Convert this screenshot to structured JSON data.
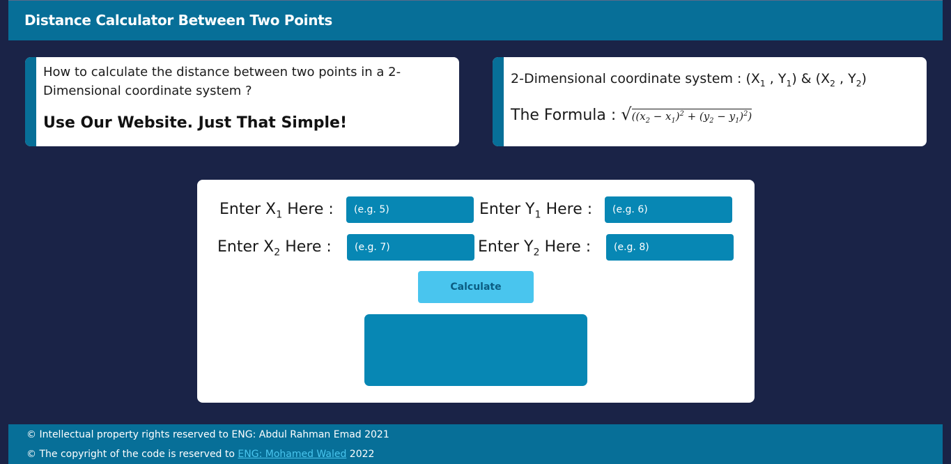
{
  "header": {
    "title": "Distance Calculator Between Two Points"
  },
  "info_card": {
    "question": "How to calculate the distance between two points in a 2-Dimensional coordinate system ?",
    "slogan": "Use Our Website. Just That Simple!"
  },
  "formula_card": {
    "system_label": "2-Dimensional coordinate system : ",
    "formula_label": "The Formula : "
  },
  "form": {
    "x1_label": "Enter X",
    "y1_label": "Enter Y",
    "x2_label": "Enter X",
    "y2_label": "Enter Y",
    "here": " Here :",
    "x1_placeholder": "(e.g. 5)",
    "y1_placeholder": "(e.g. 6)",
    "x2_placeholder": "(e.g. 7)",
    "y2_placeholder": "(e.g. 8)",
    "calculate_label": "Calculate",
    "result": ""
  },
  "footer": {
    "line1": "© Intellectual property rights reserved to ENG: Abdul Rahman Emad 2021",
    "line2_prefix": "© The copyright of the code is reserved to ",
    "line2_link": "ENG: Mohamed Waled",
    "line2_suffix": " 2022"
  },
  "colors": {
    "background": "#1a2347",
    "brand_blue": "#076f98",
    "input_blue": "#0787b4",
    "button_light_blue": "#49c5ee"
  }
}
